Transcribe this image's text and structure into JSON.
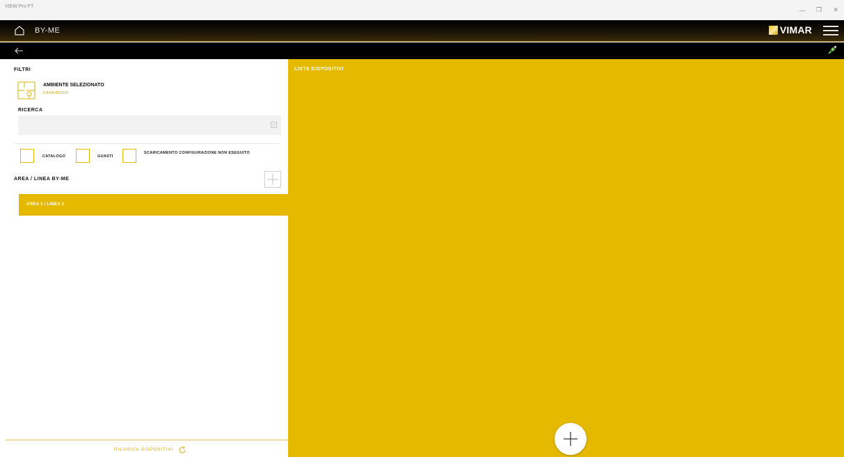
{
  "window": {
    "title": "VIEW Pro FT"
  },
  "header": {
    "title": "BY-ME",
    "brand": "VIMAR"
  },
  "filters": {
    "title": "FILTRI",
    "ambient_title": "AMBIENTE SELEZIONATO",
    "ambient_value": "CASA ROSSI",
    "search_label": "RICERCA",
    "search_value": "",
    "checkboxes": [
      {
        "label": "CATALOGO",
        "checked": false
      },
      {
        "label": "GUASTI",
        "checked": false
      },
      {
        "label": "SCARICAMENTO CONFIGURAZIONE NON ESEGUITO",
        "checked": false
      }
    ]
  },
  "areas": {
    "title": "AREA / LINEA BY-ME",
    "items": [
      {
        "label": "AREA 1 / LINEA 0"
      }
    ]
  },
  "footer": {
    "reload_label": "RICARICA DISPOSITIVI"
  },
  "devices": {
    "title": "LISTA DISPOSITIVI"
  },
  "colors": {
    "accent": "#e4b900",
    "header_bg": "#000000",
    "panel_bg": "#ffffff"
  }
}
